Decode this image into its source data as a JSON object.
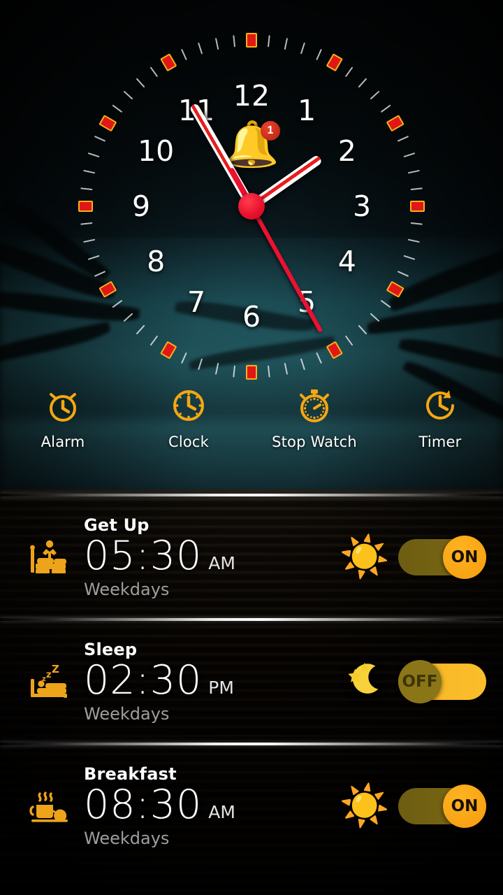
{
  "clock": {
    "numerals": [
      "12",
      "1",
      "2",
      "3",
      "4",
      "5",
      "6",
      "7",
      "8",
      "9",
      "10",
      "11"
    ],
    "bell_icon": "bell-icon",
    "bell_badge": "1",
    "hour_hand_deg": 55,
    "minute_hand_deg": 330,
    "second_hand_deg": 151,
    "marker_fill": "#e11717",
    "marker_border": "#f5b216",
    "hand_accent": "#e81d1d",
    "second_hand_color": "#ec1130"
  },
  "nav": {
    "items": [
      {
        "label": "Alarm",
        "icon": "alarm-clock-icon"
      },
      {
        "label": "Clock",
        "icon": "clock-icon"
      },
      {
        "label": "Stop Watch",
        "icon": "stopwatch-icon"
      },
      {
        "label": "Timer",
        "icon": "timer-icon"
      }
    ],
    "accent": "#f5a712"
  },
  "alarms": [
    {
      "label": "Get Up",
      "time": "05:30",
      "meridiem": "AM",
      "days": "Weekdays",
      "icon": "wake-up-in-bed-icon",
      "emoji": "sun-smiling-icon",
      "toggle_label": "ON",
      "enabled": true
    },
    {
      "label": "Sleep",
      "time": "02:30",
      "meridiem": "PM",
      "days": "Weekdays",
      "icon": "sleeping-in-bed-icon",
      "emoji": "crescent-moon-stars-icon",
      "toggle_label": "OFF",
      "enabled": false
    },
    {
      "label": "Breakfast",
      "time": "08:30",
      "meridiem": "AM",
      "days": "Weekdays",
      "icon": "coffee-cup-teapot-icon",
      "emoji": "sun-smiling-icon",
      "toggle_label": "ON",
      "enabled": true
    }
  ],
  "colors": {
    "accent": "#f5a712",
    "toggle_on_track": "#6d5d12",
    "toggle_on_knob": "#ffb41f",
    "toggle_off_track": "#f9b928",
    "toggle_off_knob": "#8a7617",
    "text_primary": "#ffffff",
    "text_secondary": "#9e9e9e"
  }
}
